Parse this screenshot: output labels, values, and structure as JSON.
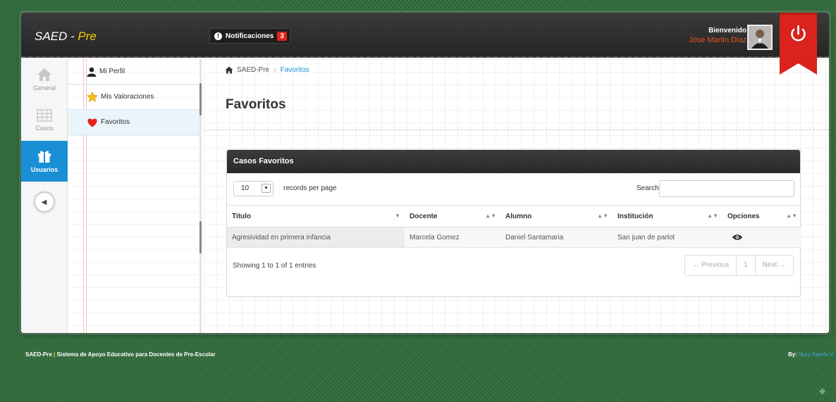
{
  "brand": {
    "name": "SAED",
    "separator": " - ",
    "accent": "Pre"
  },
  "notifications": {
    "label": "Notificaciones",
    "count": "3"
  },
  "user": {
    "greeting": "Bienvenido",
    "name": "Jose Martin Diaz"
  },
  "sidebar": {
    "items": [
      {
        "label": "General",
        "icon": "home-icon"
      },
      {
        "label": "Casos",
        "icon": "grid-icon"
      },
      {
        "label": "Usuarios",
        "icon": "gift-icon"
      }
    ]
  },
  "subnav": {
    "items": [
      {
        "label": "Mi Perfil",
        "icon": "user-icon"
      },
      {
        "label": "Mis Valoraciones",
        "icon": "star-icon"
      },
      {
        "label": "Favoritos",
        "icon": "heart-icon"
      }
    ]
  },
  "breadcrumb": {
    "home": "SAED-Pre",
    "sep": "»",
    "current": "Favoritos"
  },
  "page": {
    "title": "Favoritos"
  },
  "panel": {
    "title": "Casos Favoritos",
    "length_value": "10",
    "length_label": "records per page",
    "search_label": "Search:",
    "columns": [
      "Titulo",
      "Docente",
      "Alumno",
      "Institución",
      "Opciones"
    ],
    "rows": [
      {
        "titulo": "Agresividad en primera infancia",
        "docente": "Marcela Gomez",
        "alumno": "Daniel Santamaria",
        "institucion": "San juan de parlot"
      }
    ],
    "info": "Showing 1 to 1 of 1 entries",
    "pager": {
      "prev": "← Previous",
      "page": "1",
      "next": "Next →"
    }
  },
  "footer": {
    "app": "SAED-Pre",
    "sep": "|",
    "text": "Sistema de Apoyo Educativo para Docentes de Pre-Escolar",
    "by_label": "By:",
    "by_author": "Nury Farelo V."
  },
  "colors": {
    "accent": "#1a8fd6",
    "brand_accent": "#f0d000",
    "danger": "#d9231c",
    "user_name": "#e8541c"
  }
}
